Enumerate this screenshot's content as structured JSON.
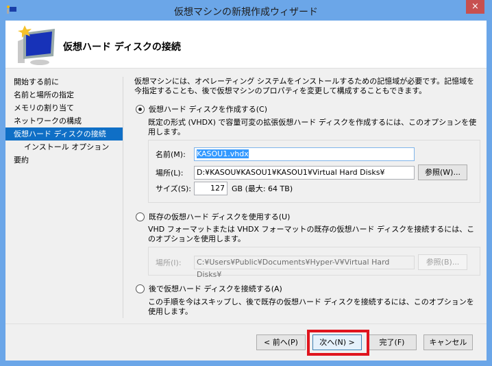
{
  "window": {
    "title": "仮想マシンの新規作成ウィザード",
    "close": "×"
  },
  "header": {
    "title": "仮想ハード ディスクの接続"
  },
  "nav": [
    {
      "label": "開始する前に"
    },
    {
      "label": "名前と場所の指定"
    },
    {
      "label": "メモリの割り当て"
    },
    {
      "label": "ネットワークの構成"
    },
    {
      "label": "仮想ハード ディスクの接続",
      "selected": true
    },
    {
      "label": "インストール オプション"
    },
    {
      "label": "要約"
    }
  ],
  "content": {
    "intro": "仮想マシンには、オペレーティング システムをインストールするための記憶域が必要です。記憶域を今指定することも、後で仮想マシンのプロパティを変更して構成することもできます。",
    "opt_create": {
      "label": "仮想ハード ディスクを作成する(C)",
      "desc": "既定の形式 (VHDX) で容量可変の拡張仮想ハード ディスクを作成するには、このオプションを使用します。",
      "name_label": "名前(M):",
      "name_value": "KASOU1.vhdx",
      "location_label": "場所(L):",
      "location_value": "D:¥KASOU¥KASOU1¥KASOU1¥Virtual Hard Disks¥",
      "browse": "参照(W)...",
      "size_label": "サイズ(S):",
      "size_value": "127",
      "size_unit": "GB (最大: 64 TB)"
    },
    "opt_existing": {
      "label": "既存の仮想ハード ディスクを使用する(U)",
      "desc": "VHD フォーマットまたは VHDX フォーマットの既存の仮想ハード ディスクを接続するには、このオプションを使用します。",
      "location_label": "場所(I):",
      "location_value": "C:¥Users¥Public¥Documents¥Hyper-V¥Virtual Hard Disks¥",
      "browse": "参照(B)..."
    },
    "opt_later": {
      "label": "後で仮想ハード ディスクを接続する(A)",
      "desc": "この手順を今はスキップし、後で既存の仮想ハード ディスクを接続するには、このオプションを使用します。"
    }
  },
  "footer": {
    "back": "< 前へ(P)",
    "next": "次へ(N) >",
    "finish": "完了(F)",
    "cancel": "キャンセル"
  }
}
